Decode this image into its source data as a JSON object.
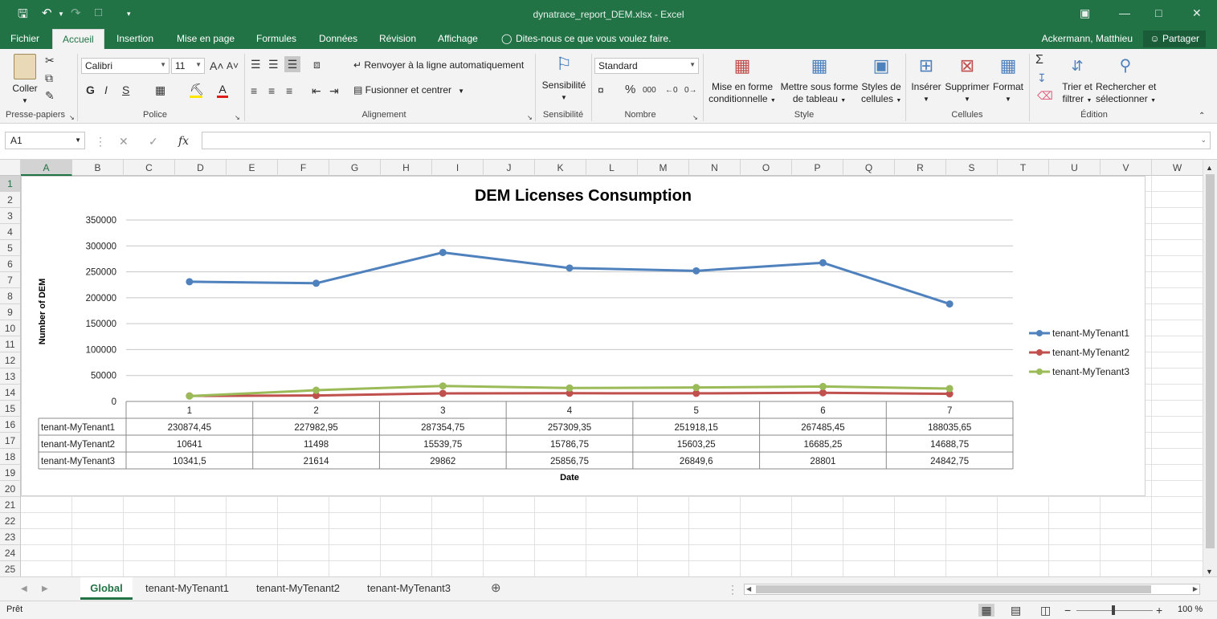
{
  "app": {
    "doc_title": "dynatrace_report_DEM.xlsx - Excel"
  },
  "ribbon_tabs": [
    "Fichier",
    "Accueil",
    "Insertion",
    "Mise en page",
    "Formules",
    "Données",
    "Révision",
    "Affichage"
  ],
  "tell_me": "Dites-nous ce que vous voulez faire.",
  "user": "Ackermann, Matthieu",
  "share_label": "Partager",
  "ribbon": {
    "paste": "Coller",
    "clipboard_label": "Presse-papiers",
    "font_name": "Calibri",
    "font_size": "11",
    "bold": "G",
    "italic": "I",
    "underline": "S",
    "font_label": "Police",
    "wrap_text": "Renvoyer à la ligne automatiquement",
    "merge_center": "Fusionner et centrer",
    "alignment_label": "Alignement",
    "sensitivity": "Sensibilité",
    "sensitivity_label": "Sensibilité",
    "number_format": "Standard",
    "percent": "%",
    "thousands": "000",
    "number_label": "Nombre",
    "cond_format_1": "Mise en forme",
    "cond_format_2": "conditionnelle",
    "format_table_1": "Mettre sous forme",
    "format_table_2": "de tableau",
    "cell_styles_1": "Styles de",
    "cell_styles_2": "cellules",
    "style_label": "Style",
    "insert": "Insérer",
    "delete": "Supprimer",
    "format": "Format",
    "cells_label": "Cellules",
    "sort_1": "Trier et",
    "sort_2": "filtrer",
    "find_1": "Rechercher et",
    "find_2": "sélectionner",
    "editing_label": "Édition"
  },
  "formula_bar": {
    "name_box": "A1",
    "fx": "fx",
    "value": ""
  },
  "columns": [
    "A",
    "B",
    "C",
    "D",
    "E",
    "F",
    "G",
    "H",
    "I",
    "J",
    "K",
    "L",
    "M",
    "N",
    "O",
    "P",
    "Q",
    "R",
    "S",
    "T",
    "U",
    "V",
    "W"
  ],
  "rows": [
    "1",
    "2",
    "3",
    "4",
    "5",
    "6",
    "7",
    "8",
    "9",
    "10",
    "11",
    "12",
    "13",
    "14",
    "15",
    "16",
    "17",
    "18",
    "19",
    "20",
    "21",
    "22",
    "23",
    "24",
    "25"
  ],
  "chart_data": {
    "type": "line",
    "title": "DEM Licenses Consumption",
    "xlabel": "Date",
    "ylabel": "Number of DEM",
    "categories": [
      "1",
      "2",
      "3",
      "4",
      "5",
      "6",
      "7"
    ],
    "ylim": [
      0,
      350000
    ],
    "yticks": [
      "0",
      "50000",
      "100000",
      "150000",
      "200000",
      "250000",
      "300000",
      "350000"
    ],
    "grid": true,
    "legend_position": "right",
    "data_table": true,
    "series": [
      {
        "name": "tenant-MyTenant1",
        "color": "#4f81bd",
        "values": [
          230874.45,
          227982.95,
          287354.75,
          257309.35,
          251918.15,
          267485.45,
          188035.65
        ],
        "labels": [
          "230874,45",
          "227982,95",
          "287354,75",
          "257309,35",
          "251918,15",
          "267485,45",
          "188035,65"
        ]
      },
      {
        "name": "tenant-MyTenant2",
        "color": "#c0504d",
        "values": [
          10641,
          11498,
          15539.75,
          15786.75,
          15603.25,
          16685.25,
          14688.75
        ],
        "labels": [
          "10641",
          "11498",
          "15539,75",
          "15786,75",
          "15603,25",
          "16685,25",
          "14688,75"
        ]
      },
      {
        "name": "tenant-MyTenant3",
        "color": "#9bbb59",
        "values": [
          10341.5,
          21614,
          29862,
          25856.75,
          26849.6,
          28801,
          24842.75
        ],
        "labels": [
          "10341,5",
          "21614",
          "29862",
          "25856,75",
          "26849,6",
          "28801",
          "24842,75"
        ]
      }
    ]
  },
  "sheets": [
    "Global",
    "tenant-MyTenant1",
    "tenant-MyTenant2",
    "tenant-MyTenant3"
  ],
  "status": {
    "ready": "Prêt",
    "zoom": "100 %"
  }
}
